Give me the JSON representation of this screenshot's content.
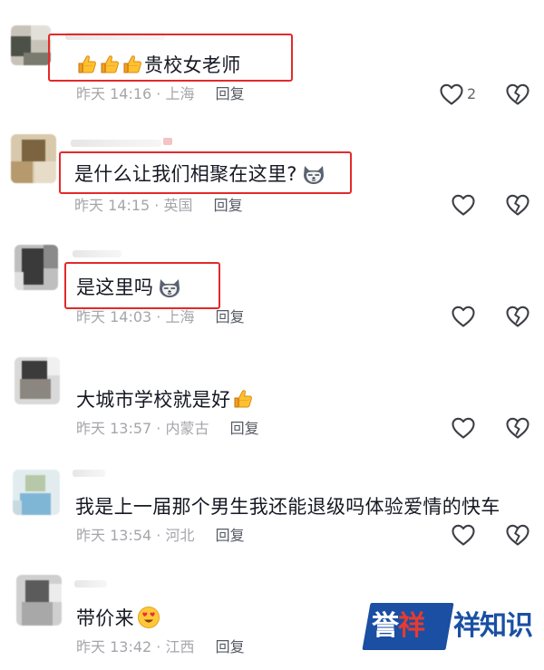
{
  "comments": [
    {
      "text": "贵校女老师",
      "emoji_prefix": [
        "thumbs-up-icon",
        "thumbs-up-icon",
        "thumbs-up-icon"
      ],
      "time_location": "昨天 14:16 · 上海",
      "reply_label": "回复",
      "like_count": "2",
      "highlighted": true
    },
    {
      "text": "是什么让我们相聚在这里?",
      "emoji_suffix": "husky-emoji-icon",
      "time_location": "昨天 14:15 · 英国",
      "reply_label": "回复",
      "like_count": "",
      "highlighted": true
    },
    {
      "text": "是这里吗",
      "emoji_suffix": "husky-emoji-icon",
      "time_location": "昨天 14:03 · 上海",
      "reply_label": "回复",
      "like_count": "",
      "highlighted": true
    },
    {
      "text": "大城市学校就是好",
      "emoji_suffix": "thumbs-up-icon",
      "time_location": "昨天 13:57 · 内蒙古",
      "reply_label": "回复",
      "like_count": ""
    },
    {
      "text": "我是上一届那个男生我还能退级吗体验爱情的快车",
      "time_location": "昨天 13:54 · 河北",
      "reply_label": "回复",
      "like_count": ""
    },
    {
      "text": "带价来",
      "emoji_suffix": "heart-eyes-emoji-icon",
      "time_location": "昨天 13:42 · 江西",
      "reply_label": "回复",
      "like_count": ""
    }
  ],
  "watermark": {
    "part_a_1": "誉",
    "part_a_2": "祥",
    "part_b": "祥知识"
  },
  "colors": {
    "highlight_border": "#e32a2a",
    "meta_gray": "#a5a6ab",
    "text_dark": "#161823",
    "watermark_blue": "#1a4fa3",
    "watermark_red": "#e73a2f"
  }
}
